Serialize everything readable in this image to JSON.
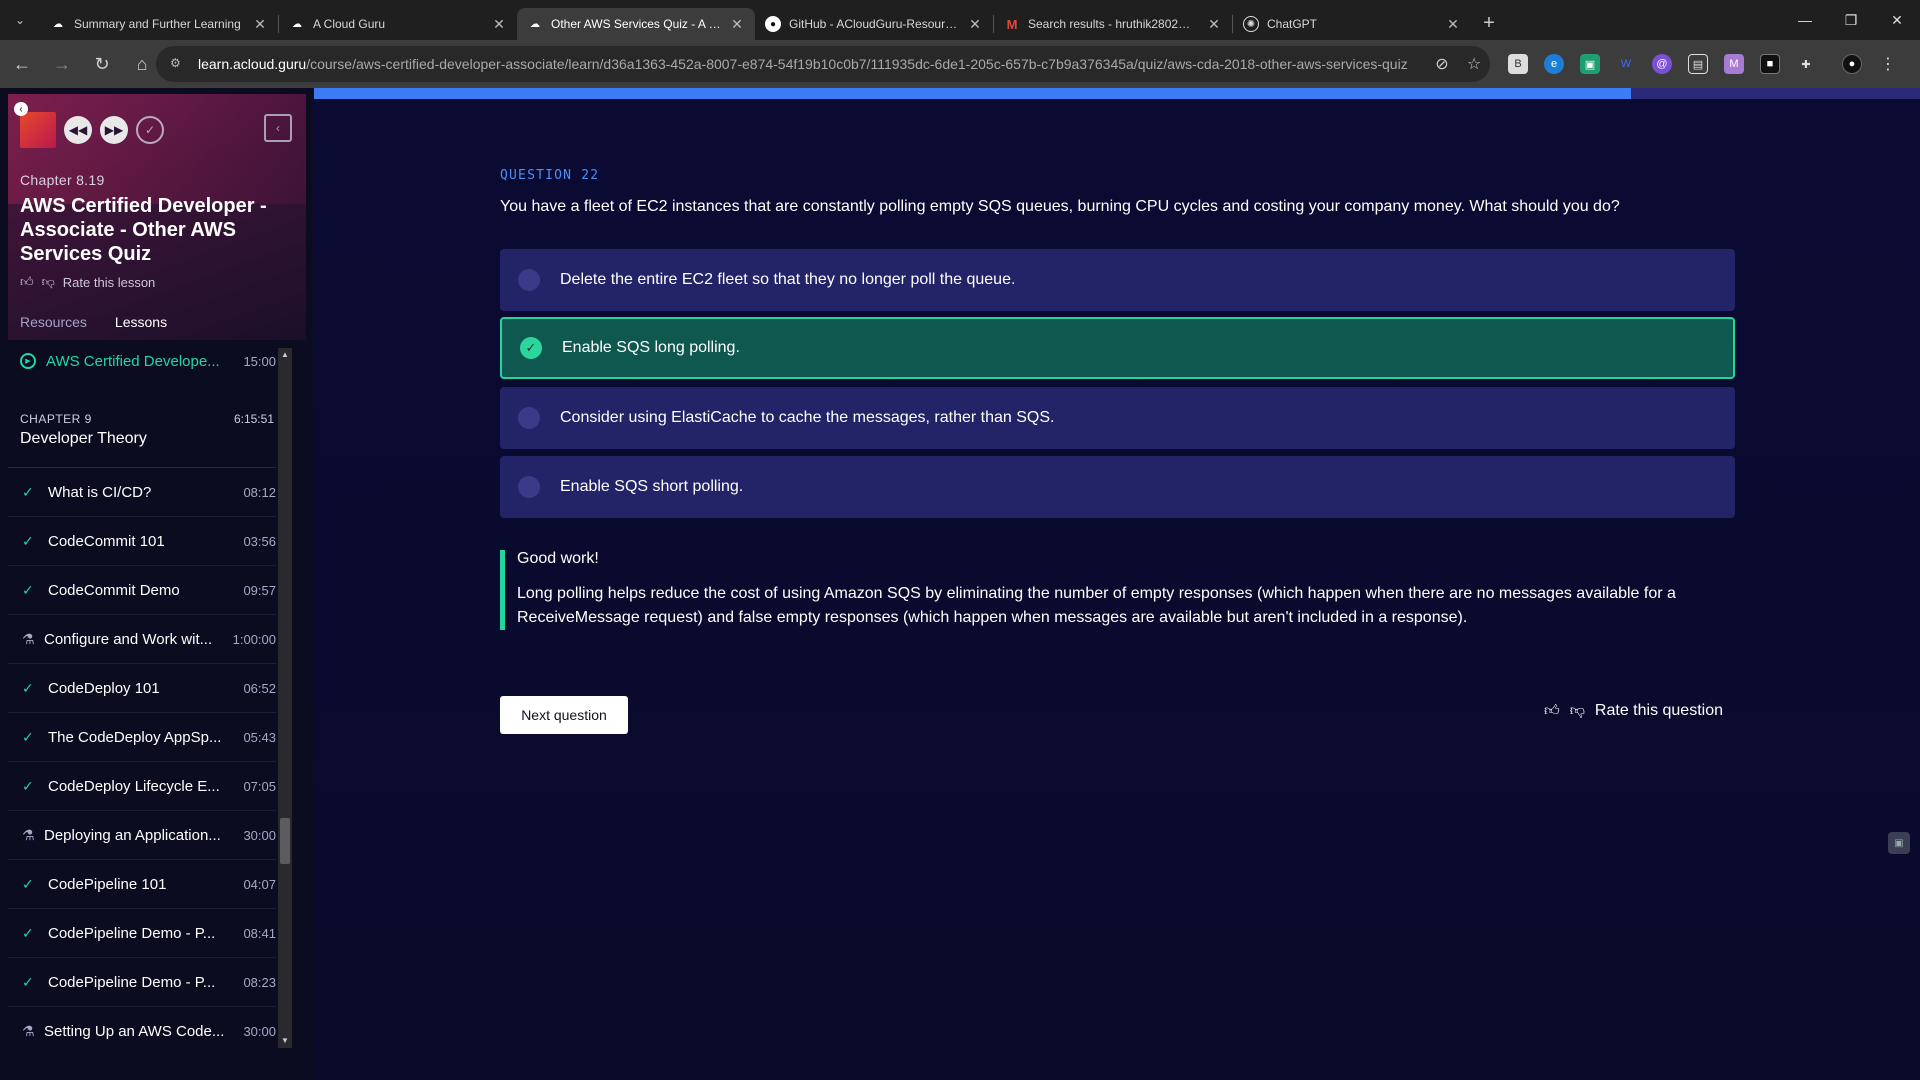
{
  "browser": {
    "tabs": [
      {
        "title": "Summary and Further Learning",
        "icon": "acloudguru-cloud-icon",
        "active": false
      },
      {
        "title": "A Cloud Guru",
        "icon": "acloudguru-cloud-icon",
        "active": false
      },
      {
        "title": "Other AWS Services Quiz - A Cl...",
        "icon": "acloudguru-cloud-icon",
        "active": true
      },
      {
        "title": "GitHub - ACloudGuru-Resource...",
        "icon": "github-icon",
        "active": false
      },
      {
        "title": "Search results - hruthik2802@g...",
        "icon": "gmail-icon",
        "active": false
      },
      {
        "title": "ChatGPT",
        "icon": "chatgpt-icon",
        "active": false
      }
    ],
    "url_host": "learn.acloud.guru",
    "url_path": "/course/aws-certified-developer-associate/learn/d36a1363-452a-8007-e874-54f19b10c0b7/111935dc-6de1-205c-657b-c7b9a376345a/quiz/aws-cda-2018-other-aws-services-quiz"
  },
  "sidebar": {
    "chapter_label": "Chapter 8.19",
    "lesson_title": "AWS Certified Developer - Associate - Other AWS Services Quiz",
    "rate_label": "Rate this lesson",
    "tabs": [
      "Resources",
      "Lessons"
    ],
    "current_lesson": {
      "title": "AWS Certified Develope...",
      "duration": "15:00"
    },
    "chapter9": {
      "label": "CHAPTER 9",
      "duration": "6:15:51",
      "name": "Developer Theory"
    },
    "lessons": [
      {
        "title": "What is CI/CD?",
        "duration": "08:12",
        "type": "done"
      },
      {
        "title": "CodeCommit 101",
        "duration": "03:56",
        "type": "done"
      },
      {
        "title": "CodeCommit Demo",
        "duration": "09:57",
        "type": "done"
      },
      {
        "title": "Configure and Work wit...",
        "duration": "1:00:00",
        "type": "lab"
      },
      {
        "title": "CodeDeploy 101",
        "duration": "06:52",
        "type": "done"
      },
      {
        "title": "The CodeDeploy AppSp...",
        "duration": "05:43",
        "type": "done"
      },
      {
        "title": "CodeDeploy Lifecycle E...",
        "duration": "07:05",
        "type": "done"
      },
      {
        "title": "Deploying an Application...",
        "duration": "30:00",
        "type": "lab"
      },
      {
        "title": "CodePipeline 101",
        "duration": "04:07",
        "type": "done"
      },
      {
        "title": "CodePipeline Demo - P...",
        "duration": "08:41",
        "type": "done"
      },
      {
        "title": "CodePipeline Demo - P...",
        "duration": "08:23",
        "type": "done"
      },
      {
        "title": "Setting Up an AWS Code...",
        "duration": "30:00",
        "type": "lab"
      }
    ]
  },
  "quiz": {
    "progress_percent": 82,
    "question_number": "QUESTION 22",
    "question": "You have a fleet of EC2 instances that are constantly polling empty SQS queues, burning CPU cycles and costing your company money. What should you do?",
    "answers": [
      {
        "text": "Delete the entire EC2 fleet so that they no longer poll the queue.",
        "correct": false
      },
      {
        "text": "Enable SQS long polling.",
        "correct": true
      },
      {
        "text": "Consider using ElastiCache to cache the messages, rather than SQS.",
        "correct": false
      },
      {
        "text": "Enable SQS short polling.",
        "correct": false
      }
    ],
    "feedback_head": "Good work!",
    "feedback_body": "Long polling helps reduce the cost of using Amazon SQS by eliminating the number of empty responses (which happen when there are no messages available for a ReceiveMessage request) and false empty responses (which happen when messages are available but aren't included in a response).",
    "next_label": "Next question",
    "rate_label": "Rate this question"
  },
  "colors": {
    "accent_green": "#22d69e",
    "accent_blue": "#3b7cf5",
    "answer_bg": "#232367"
  }
}
